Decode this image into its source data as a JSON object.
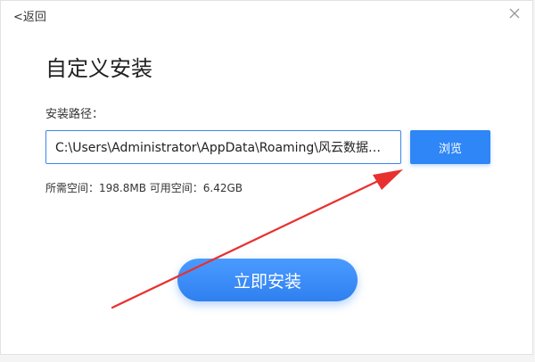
{
  "header": {
    "back_label": "<返回"
  },
  "icons": {
    "close": "close-icon"
  },
  "main": {
    "title": "自定义安装",
    "path_label": "安装路径：",
    "path_value": "C:\\Users\\Administrator\\AppData\\Roaming\\风云数据恢...",
    "browse_label": "浏览",
    "space_info": "所需空间：198.8MB  可用空间：6.42GB",
    "install_label": "立即安装"
  },
  "colors": {
    "accent": "#2f86f6",
    "annotation_arrow": "#e8312f"
  }
}
